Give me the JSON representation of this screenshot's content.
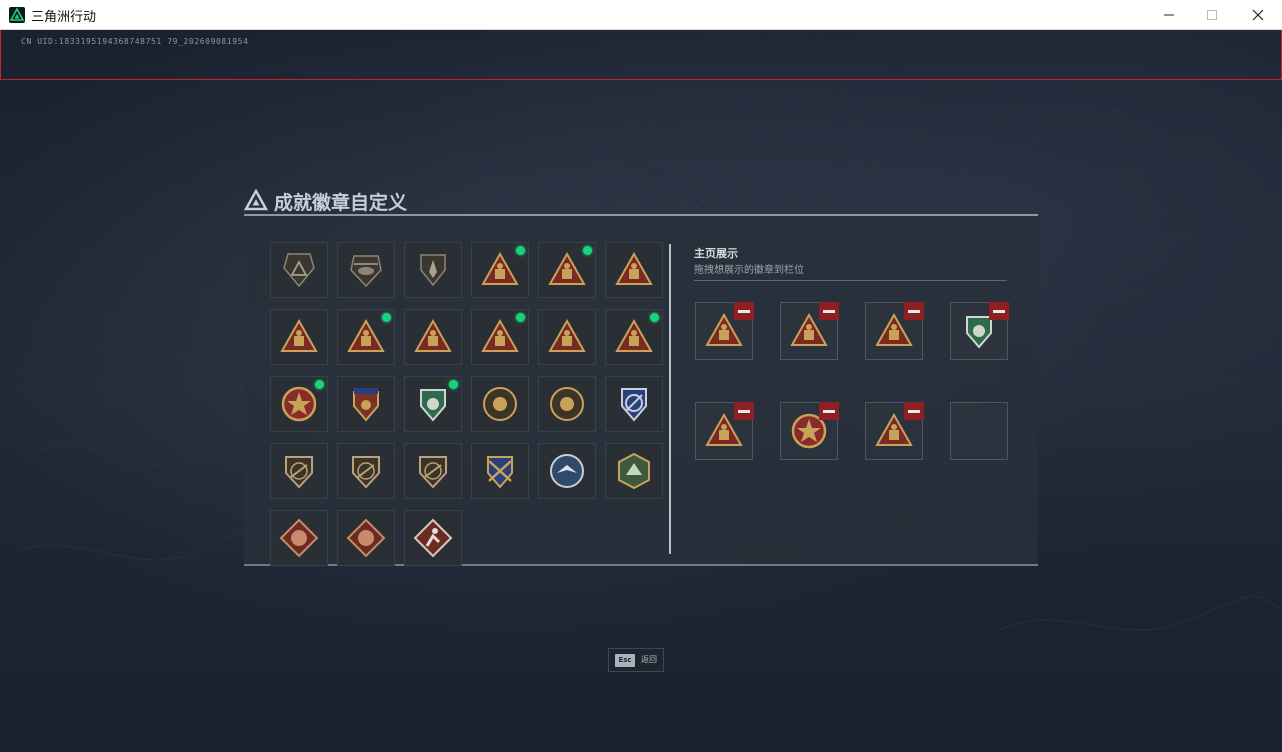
{
  "window": {
    "title": "三角洲行动",
    "minimize_icon": "minimize-icon",
    "maximize_icon": "maximize-icon",
    "close_icon": "close-icon"
  },
  "uid_text": "CN UID:1833195194368748751 79_202609081954",
  "page_title": "成就徽章自定义",
  "badge_grid": [
    {
      "icon": "triangle-mountain-badge",
      "new": false
    },
    {
      "icon": "helicopter-badge",
      "new": false
    },
    {
      "icon": "arrow-shield-badge",
      "new": false
    },
    {
      "icon": "cargo-triangle-badge",
      "new": true
    },
    {
      "icon": "vest-56-triangle-badge",
      "new": true
    },
    {
      "icon": "crate-triangle-badge",
      "new": false
    },
    {
      "icon": "barrel-58-triangle-badge",
      "new": false
    },
    {
      "icon": "ship-triangle-badge",
      "new": true
    },
    {
      "icon": "number-one-triangle-badge",
      "new": false
    },
    {
      "icon": "vault-triangle-badge",
      "new": true
    },
    {
      "icon": "soldier-triangle-badge",
      "new": false
    },
    {
      "icon": "rocket-triangle-badge",
      "new": true
    },
    {
      "icon": "red-star-medal-badge",
      "new": true
    },
    {
      "icon": "stars-shield-medal-badge",
      "new": false
    },
    {
      "icon": "green-eagle-shield-badge",
      "new": true
    },
    {
      "icon": "skull-round-badge",
      "new": false
    },
    {
      "icon": "wings-round-badge",
      "new": false
    },
    {
      "icon": "blue-compass-badge",
      "new": false
    },
    {
      "icon": "gun-shield-badge-1",
      "new": false
    },
    {
      "icon": "gun-shield-badge-2",
      "new": false
    },
    {
      "icon": "gun-shield-badge-3",
      "new": false
    },
    {
      "icon": "crossed-rifles-badge",
      "new": false
    },
    {
      "icon": "eagle-round-badge",
      "new": false
    },
    {
      "icon": "green-wolf-hex-badge",
      "new": false
    },
    {
      "icon": "dragon-diamond-badge-1",
      "new": false
    },
    {
      "icon": "dragon-diamond-badge-2",
      "new": false
    },
    {
      "icon": "runner-diamond-badge",
      "new": false
    }
  ],
  "showcase": {
    "title": "主页展示",
    "subtitle": "拖拽想展示的徽章到栏位",
    "slots": [
      {
        "icon": "vault-triangle-badge",
        "filled": true
      },
      {
        "icon": "cargo-triangle-badge",
        "filled": true
      },
      {
        "icon": "barrel-58-triangle-badge",
        "filled": true
      },
      {
        "icon": "green-eagle-shield-badge",
        "filled": true
      },
      {
        "icon": "ship-triangle-badge",
        "filled": true
      },
      {
        "icon": "red-star-medal-badge",
        "filled": true
      },
      {
        "icon": "rocket-triangle-badge",
        "filled": true
      },
      {
        "icon": "",
        "filled": false
      }
    ]
  },
  "footer": {
    "key_label": "Esc",
    "action_label": "返回"
  },
  "colors": {
    "gold": "#c9a25a",
    "dark_red": "#7a2a22",
    "new_indicator": "#19d37a",
    "remove_button": "#8e2024",
    "green_shield": "#2f6b4a",
    "blue_badge": "#2b3f7a"
  }
}
